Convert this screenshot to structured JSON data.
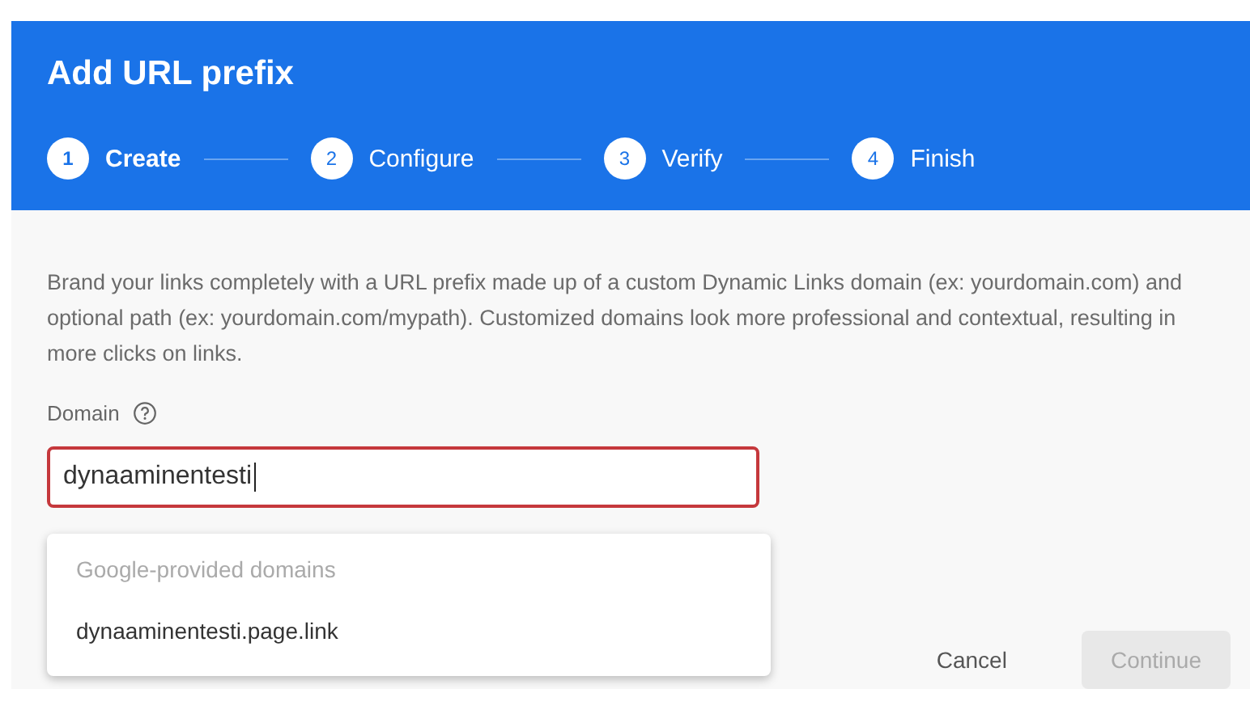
{
  "dialog": {
    "title": "Add URL prefix"
  },
  "steps": [
    {
      "number": "1",
      "label": "Create",
      "selected": true
    },
    {
      "number": "2",
      "label": "Configure",
      "selected": false
    },
    {
      "number": "3",
      "label": "Verify",
      "selected": false
    },
    {
      "number": "4",
      "label": "Finish",
      "selected": false
    }
  ],
  "description": "Brand your links completely with a URL prefix made up of a custom Dynamic Links domain (ex: yourdomain.com) and optional path (ex: yourdomain.com/mypath). Customized domains look more professional and contextual, resulting in more clicks on links.",
  "domain_field": {
    "label": "Domain",
    "value": "dynaaminentesti",
    "invalid": true
  },
  "dropdown": {
    "heading": "Google-provided domains",
    "options": [
      "dynaaminentesti.page.link"
    ]
  },
  "buttons": [
    {
      "label": "Cancel",
      "disabled": false
    },
    {
      "label": "Continue",
      "disabled": true
    }
  ]
}
